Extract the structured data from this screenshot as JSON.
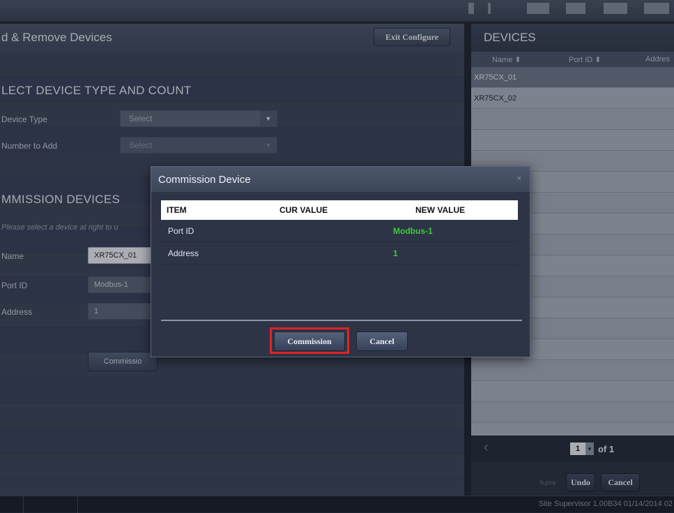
{
  "left": {
    "title": "d & Remove Devices",
    "exit_label": "Exit Configure",
    "select_section": "LECT DEVICE TYPE AND COUNT",
    "device_type_label": "Device Type",
    "device_type_value": "Select",
    "number_label": "Number to Add",
    "number_value": "Select",
    "commission_section": "MMISSION DEVICES",
    "hint": "Please select a device at right to u",
    "name_label": "Name",
    "name_value": "XR75CX_01",
    "port_label": "Port ID",
    "port_value": "Modbus-1",
    "address_label": "Address",
    "address_value": "1",
    "commission_btn": "Commissio"
  },
  "devices": {
    "title": "DEVICES",
    "columns": [
      "Name ⬍",
      "Port ID ⬍",
      "Addres"
    ],
    "rows": [
      "XR75CX_01",
      "XR75CX_02"
    ],
    "page": "1",
    "page_of": "of 1",
    "save": "Save",
    "undo": "Undo",
    "cancel": "Cancel"
  },
  "modal": {
    "title": "Commission Device",
    "close": "×",
    "headers": [
      "ITEM",
      "CUR VALUE",
      "NEW VALUE"
    ],
    "rows": [
      {
        "item": "Port ID",
        "cur": "",
        "new": "Modbus-1"
      },
      {
        "item": "Address",
        "cur": "",
        "new": "1"
      }
    ],
    "commission": "Commission",
    "cancel": "Cancel"
  },
  "status": {
    "text": "Site Supervisor 1.00B34 01/14/2014 02"
  },
  "colors": {
    "new_value": "#3ecb3a",
    "highlight": "#e02424"
  }
}
